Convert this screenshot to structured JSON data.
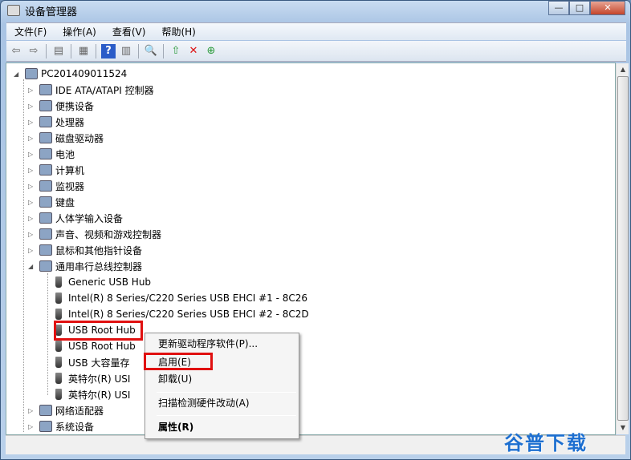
{
  "window": {
    "title": "设备管理器",
    "minimize": "—",
    "maximize": "□",
    "close": "✕"
  },
  "menubar": [
    "文件(F)",
    "操作(A)",
    "查看(V)",
    "帮助(H)"
  ],
  "toolbar": [
    "back-icon",
    "forward-icon",
    "show-hide-tree-icon",
    "properties-icon",
    "help-icon",
    "action-pane-icon",
    "scan-hardware-icon",
    "update-driver-icon",
    "disable-device-icon",
    "enable-device-icon"
  ],
  "tree": {
    "root": "PC201409011524",
    "categories": [
      "IDE ATA/ATAPI 控制器",
      "便携设备",
      "处理器",
      "磁盘驱动器",
      "电池",
      "计算机",
      "监视器",
      "键盘",
      "人体学输入设备",
      "声音、视频和游戏控制器",
      "鼠标和其他指针设备",
      "通用串行总线控制器"
    ],
    "usb_children": [
      "Generic USB Hub",
      "Intel(R) 8 Series/C220 Series USB EHCI #1 - 8C26",
      "Intel(R) 8 Series/C220 Series USB EHCI #2 - 8C2D",
      "USB Root Hub",
      "USB Root Hub",
      "USB 大容量存",
      "英特尔(R) USI",
      "英特尔(R) USI"
    ],
    "after": [
      "网络适配器",
      "系统设备"
    ]
  },
  "context_menu": {
    "update": "更新驱动程序软件(P)...",
    "enable": "启用(E)",
    "uninstall": "卸载(U)",
    "scan": "扫描检测硬件改动(A)",
    "properties": "属性(R)"
  },
  "highlight_color": "#e01010",
  "watermark": "谷普下载"
}
